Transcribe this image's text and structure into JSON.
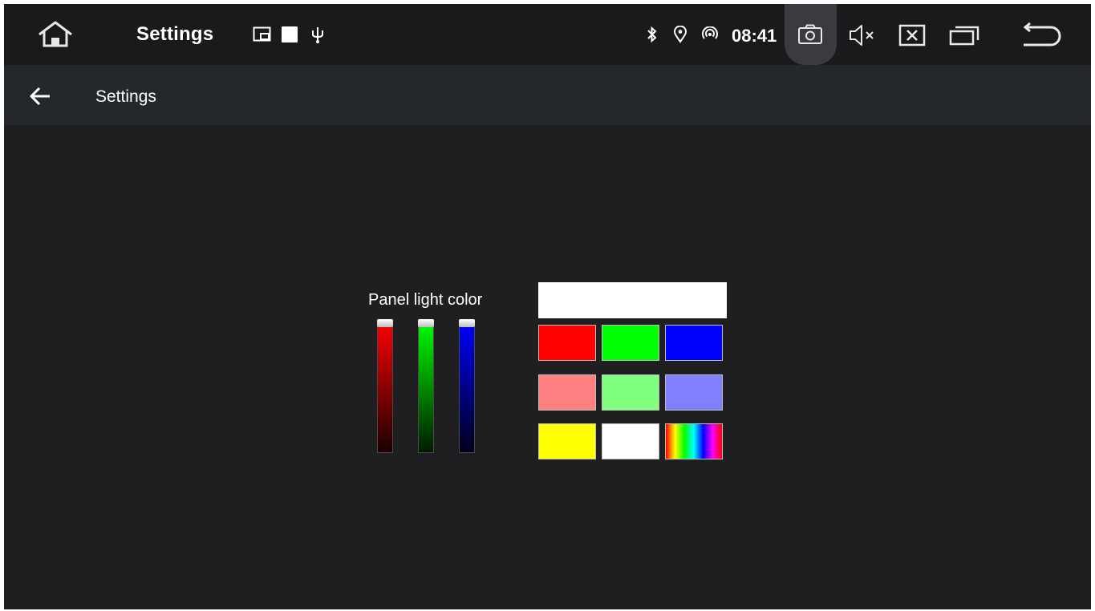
{
  "statusbar": {
    "title": "Settings",
    "time": "08:41",
    "notification_icons": [
      "picture-in-picture-icon",
      "square-icon",
      "usb-icon"
    ],
    "status_icons": [
      "bluetooth-icon",
      "location-icon",
      "hotspot-icon"
    ],
    "nav_icons": [
      "screenshot-camera-icon",
      "volume-mute-icon",
      "close-window-icon",
      "recent-apps-icon",
      "back-return-icon"
    ]
  },
  "appbar": {
    "title": "Settings",
    "back_icon": "arrow-left-icon"
  },
  "panel": {
    "label": "Panel light color",
    "sliders": [
      {
        "channel": "red",
        "color": "#ff0000",
        "value_fraction": 1.0
      },
      {
        "channel": "green",
        "color": "#00ff00",
        "value_fraction": 1.0
      },
      {
        "channel": "blue",
        "color": "#0000ff",
        "value_fraction": 1.0
      }
    ],
    "preview_color": "#ffffff",
    "swatches": [
      {
        "name": "red",
        "color": "#ff0000"
      },
      {
        "name": "green",
        "color": "#00ff00"
      },
      {
        "name": "blue",
        "color": "#0000ff"
      },
      {
        "name": "light-red",
        "color": "#ff8080"
      },
      {
        "name": "light-green",
        "color": "#80ff80"
      },
      {
        "name": "light-blue",
        "color": "#8080ff"
      },
      {
        "name": "yellow",
        "color": "#ffff00"
      },
      {
        "name": "white",
        "color": "#ffffff"
      },
      {
        "name": "rainbow",
        "color": "rainbow"
      }
    ]
  }
}
